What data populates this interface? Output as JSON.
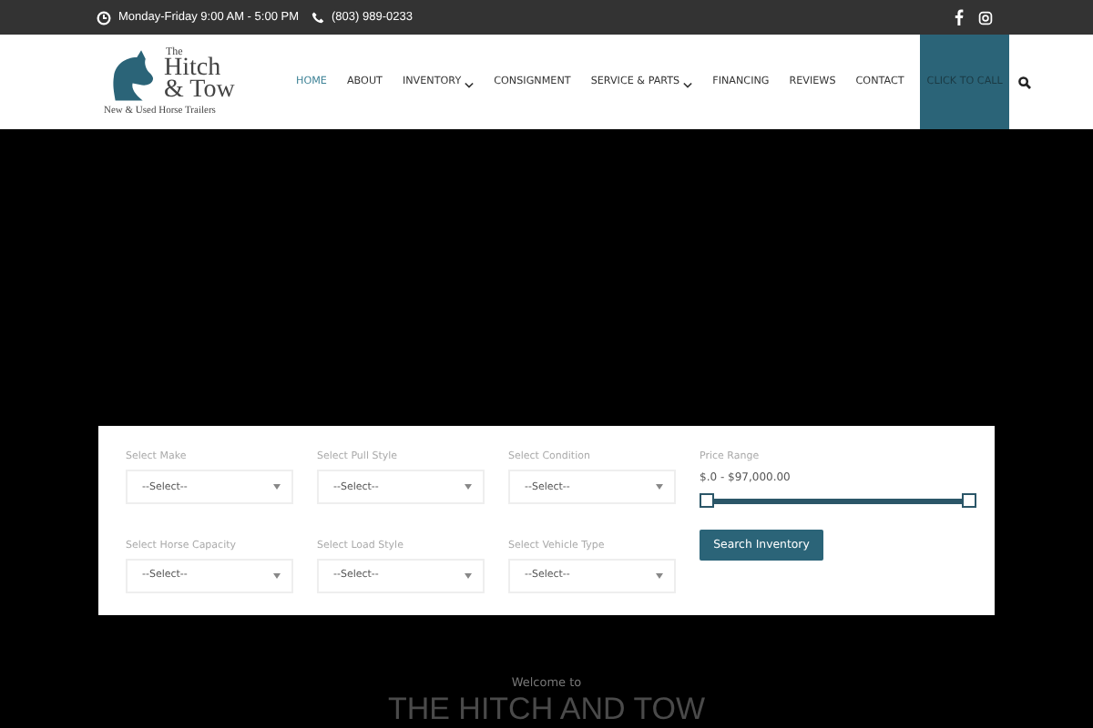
{
  "top_bar": {
    "hours": "Monday-Friday 9:00 AM - 5:00 PM",
    "phone": "(803) 989-0233"
  },
  "logo": {
    "line_1": "The",
    "line_2": "Hitch",
    "line_3": "& Tow",
    "tagline": "New & Used Horse Trailers"
  },
  "nav": [
    {
      "label": "HOME",
      "selected": true,
      "has_dropdown": false,
      "kind": "link"
    },
    {
      "label": "ABOUT",
      "selected": false,
      "has_dropdown": false,
      "kind": "link"
    },
    {
      "label": "INVENTORY",
      "selected": false,
      "has_dropdown": true,
      "kind": "link"
    },
    {
      "label": "CONSIGNMENT",
      "selected": false,
      "has_dropdown": false,
      "kind": "link"
    },
    {
      "label": "SERVICE & PARTS",
      "selected": false,
      "has_dropdown": true,
      "kind": "link"
    },
    {
      "label": "FINANCING",
      "selected": false,
      "has_dropdown": false,
      "kind": "link"
    },
    {
      "label": "REVIEWS",
      "selected": false,
      "has_dropdown": false,
      "kind": "link"
    },
    {
      "label": "CONTACT",
      "selected": false,
      "has_dropdown": false,
      "kind": "link"
    },
    {
      "label": "CLICK TO CALL",
      "selected": false,
      "has_dropdown": false,
      "kind": "cta"
    }
  ],
  "search_form": {
    "filters": [
      {
        "label": "Select Make",
        "value": "--Select--"
      },
      {
        "label": "Select Pull Style",
        "value": "--Select--"
      },
      {
        "label": "Select Condition",
        "value": "--Select--"
      },
      {
        "label": "Select Horse Capacity",
        "value": "--Select--"
      },
      {
        "label": "Select Load Style",
        "value": "--Select--"
      },
      {
        "label": "Select Vehicle Type",
        "value": "--Select--"
      }
    ],
    "price_range": {
      "label": "Price Range",
      "reading": "$.0 - $97,000.00",
      "level": 1
    },
    "button": "Search Inventory"
  },
  "welcome": {
    "intro": "Welcome to",
    "heading": "THE HITCH AND TOW"
  }
}
